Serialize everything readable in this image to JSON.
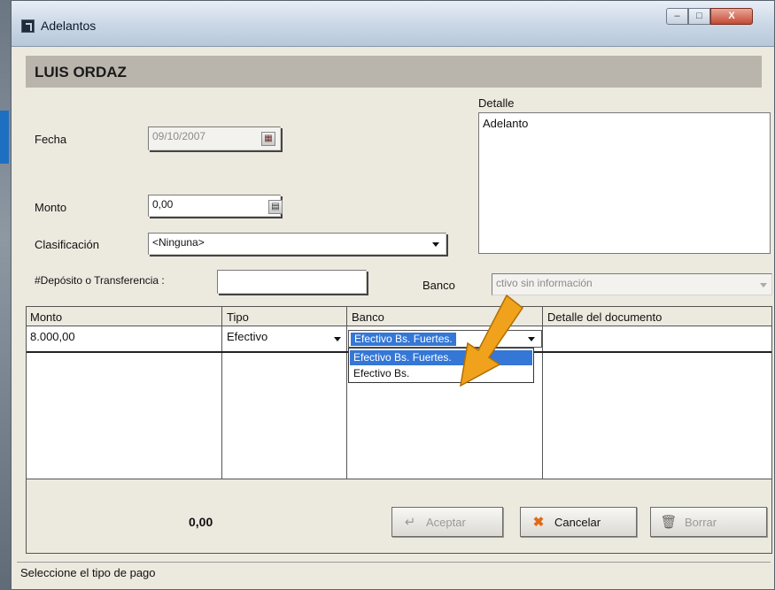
{
  "window": {
    "title": "Adelantos",
    "min_label": "–",
    "max_label": "□",
    "close_label": "X"
  },
  "header": {
    "employee_name": "LUIS ORDAZ"
  },
  "form": {
    "fecha_label": "Fecha",
    "fecha_value": "09/10/2007",
    "monto_label": "Monto",
    "monto_value": "0,00",
    "clasificacion_label": "Clasificación",
    "clasificacion_value": "<Ninguna>",
    "deposito_label": "#Depósito o Transferencia :",
    "deposito_value": "",
    "banco_label": "Banco",
    "banco_value": "ctivo sin información",
    "detalle_label": "Detalle",
    "detalle_value": "Adelanto"
  },
  "grid": {
    "columns": [
      "Monto",
      "Tipo",
      "Banco",
      "Detalle del documento"
    ],
    "rows": [
      {
        "monto": "8.000,00",
        "tipo": "Efectivo",
        "banco": "Efectivo Bs. Fuertes.",
        "detalle": ""
      }
    ],
    "dropdown_options": [
      "Efectivo Bs. Fuertes.",
      "Efectivo Bs."
    ]
  },
  "footer": {
    "total": "0,00",
    "aceptar_label": "Aceptar",
    "cancelar_label": "Cancelar",
    "borrar_label": "Borrar"
  },
  "status": {
    "text": "Seleccione el tipo de pago"
  },
  "colors": {
    "annotation_arrow": "#f0a21c",
    "selection": "#3477d6"
  }
}
